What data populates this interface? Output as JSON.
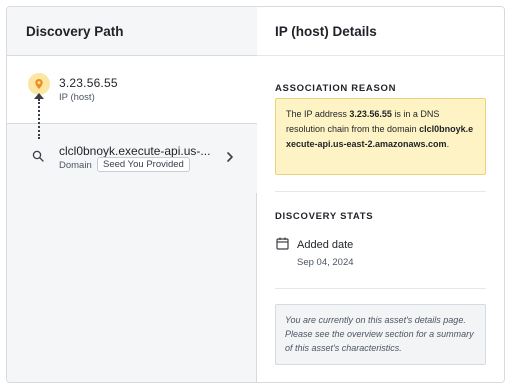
{
  "left_panel": {
    "title": "Discovery Path",
    "ip_node": {
      "title": "3.23.56.55",
      "subtitle": "IP (host)",
      "icon": "location-pin-icon"
    },
    "domain_node": {
      "title": "clcl0bnoyk.execute-api.us-...",
      "type": "Domain",
      "badge": "Seed You Provided",
      "icon": "search-icon"
    }
  },
  "right_panel": {
    "title": "IP (host) Details",
    "association_reason": {
      "heading": "ASSOCIATION REASON",
      "text_prefix": "The IP address ",
      "ip": "3.23.56.55",
      "text_middle": " is in a DNS resolution chain from the domain ",
      "domain": "clcl0bnoyk.execute-api.us-east-2.amazonaws.com",
      "text_suffix": "."
    },
    "discovery_stats": {
      "heading": "DISCOVERY STATS",
      "added_label": "Added date",
      "added_value": "Sep 04, 2024"
    },
    "info_note": "You are currently on this asset's details page. Please see the overview section for a summary of this asset's characteristics."
  },
  "colors": {
    "accent": "#f59e0b",
    "highlight_bg": "#fdf3c4",
    "highlight_border": "#ecd27a"
  }
}
